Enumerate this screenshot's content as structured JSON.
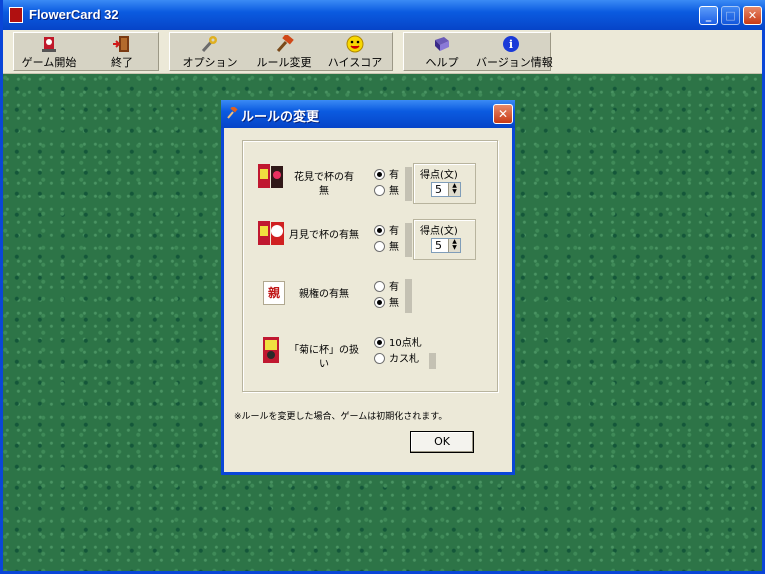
{
  "window": {
    "title": "FlowerCard 32",
    "min_icon": "minimize-icon",
    "max_icon": "maximize-icon",
    "close_icon": "close-icon"
  },
  "toolbar": {
    "items": [
      {
        "label": "ゲーム開始",
        "icon": "new-game-icon"
      },
      {
        "label": "終了",
        "icon": "exit-door-icon"
      },
      {
        "label": "オプション",
        "icon": "options-tools-icon"
      },
      {
        "label": "ルール変更",
        "icon": "rule-change-hammer-icon"
      },
      {
        "label": "ハイスコア",
        "icon": "smiley-face-icon"
      },
      {
        "label": "ヘルプ",
        "icon": "help-book-icon"
      },
      {
        "label": "バージョン情報",
        "icon": "info-icon"
      }
    ]
  },
  "dialog": {
    "title": "ルールの変更",
    "rules": [
      {
        "label_line1": "花見で杯の有",
        "label_line2": "無",
        "option_on": "有",
        "option_off": "無",
        "selected": "有",
        "score_label": "得点(文)",
        "score_value": "5"
      },
      {
        "label_line1": "月見で杯の有無",
        "option_on": "有",
        "option_off": "無",
        "selected": "有",
        "score_label": "得点(文)",
        "score_value": "5"
      },
      {
        "label_line1": "親権の有無",
        "icon_text": "親",
        "option_on": "有",
        "option_off": "無",
        "selected": "無"
      },
      {
        "label_line1": "「菊に杯」の扱い",
        "option_on": "10点札",
        "option_off": "カス札",
        "selected": "10点札"
      }
    ],
    "note": "※ルールを変更した場合、ゲームは初期化されます。",
    "ok_label": "OK"
  },
  "colors": {
    "felt": "#2d7447",
    "titlebar": "#0b5be0",
    "dialog_bg": "#ece9d8",
    "close_btn": "#c83a16"
  }
}
